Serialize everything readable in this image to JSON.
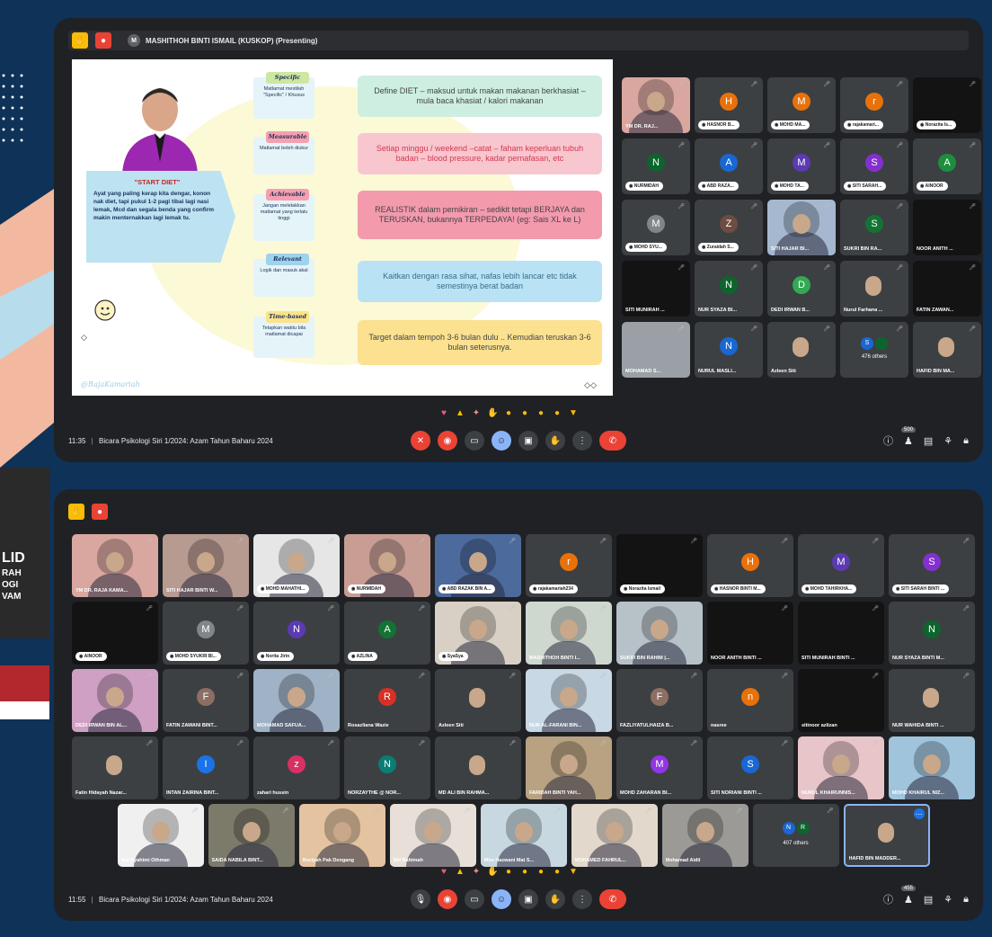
{
  "colors": {
    "bg": "#0e3258",
    "meet": "#202124",
    "tile": "#3c4043",
    "red": "#ea4335",
    "yellow": "#fbbc04",
    "blue": "#8ab4f8"
  },
  "left_poster": {
    "lines": [
      "LID",
      "RAH",
      "OGI",
      "VAM"
    ]
  },
  "window1": {
    "presenter": "MASHITHOH BINTI ISMAIL (KUSKOP) (Presenting)",
    "slide": {
      "start_title": "\"START DIET\"",
      "start_body": "Ayat yang paling kerap kita dengar, konon nak diet, tapi pukul 1-2 pagi tibai lagi nasi lemak, Mcd dan segala benda yang confirm makin menternakkan lagi lemak tu.",
      "steps": [
        {
          "tag": "Specific",
          "body": "Matlamat mestilah \"Specific\" / Khusus"
        },
        {
          "tag": "Measurable",
          "body": "Matlamat boleh diukur"
        },
        {
          "tag": "Achievable",
          "body": "Jangan meletakkan matlamat yang terlalu tinggi"
        },
        {
          "tag": "Relevant",
          "body": "Logik dan masuk akal"
        },
        {
          "tag": "Time-based",
          "body": "Tetapkan waktu bila matlamat dicapai"
        }
      ],
      "boxes": [
        "Define DIET – maksud untuk makan makanan berkhasiat – mula baca khasiat / kalori makanan",
        "Setiap minggu / weekend –catat – faham keperluan tubuh badan – blood pressure, kadar pernafasan, etc",
        "REALISTIK dalam pemikiran – sedikit tetapi BERJAYA dan TERUSKAN, bukannya TERPEDAYA! (eg: Sais XL ke L)",
        "Kaitkan dengan rasa sihat, nafas lebih lancar etc tidak semestinya berat badan",
        "Target dalam tempoh 3-6 bulan dulu .. Kemudian teruskan 3-6 bulan seterusnya."
      ],
      "watermark": "@RajaKamariah"
    },
    "time": "11:35",
    "meeting": "Bicara Psikologi Siri 1/2024: Azam Tahun Baharu 2024",
    "participants_count": "500",
    "tiles": [
      {
        "name": "YM DR. RAJ...",
        "type": "video",
        "tone": "#d9a7a0"
      },
      {
        "name": "HASNOR B...",
        "letter": "H",
        "color": "#e8710a",
        "pill": true
      },
      {
        "name": "MOHD MA...",
        "letter": "M",
        "color": "#e8710a",
        "pill": true
      },
      {
        "name": "rajakamari...",
        "letter": "r",
        "color": "#e8710a",
        "pill": true
      },
      {
        "name": "Norazita Is...",
        "type": "dark",
        "pill": true
      },
      {
        "name": "NURMIDAH",
        "letter": "N",
        "color": "#0d652d",
        "pill": true
      },
      {
        "name": "ABD RAZA...",
        "letter": "A",
        "color": "#1967d2",
        "pill": true
      },
      {
        "name": "MOHD TA...",
        "letter": "M",
        "color": "#5b3ab3",
        "pill": true
      },
      {
        "name": "SITI SARAH...",
        "letter": "S",
        "color": "#8430ce",
        "pill": true
      },
      {
        "name": "AINOOR",
        "letter": "A",
        "color": "#1e8e3e",
        "pill": true
      },
      {
        "name": "MOHD SYU...",
        "letter": "M",
        "color": "#80868b",
        "pill": true
      },
      {
        "name": "Zuraidah S...",
        "letter": "Z",
        "color": "#6d4c41",
        "pill": true
      },
      {
        "name": "SITI HAJAR BI...",
        "type": "video",
        "tone": "#a5b8cf"
      },
      {
        "name": "SUKRI BIN RA...",
        "letter": "S",
        "color": "#137333"
      },
      {
        "name": "NOOR ANITH ...",
        "type": "dark"
      },
      {
        "name": "SITI MUNIRAH ...",
        "type": "dark"
      },
      {
        "name": "NUR SYAZA BI...",
        "letter": "N",
        "color": "#0d652d"
      },
      {
        "name": "DEDI IRWAN B...",
        "letter": "D",
        "color": "#34a853"
      },
      {
        "name": "Nurul Farhana ...",
        "type": "person"
      },
      {
        "name": "FATIN ZAWAN...",
        "type": "dark"
      },
      {
        "name": "MOHAMAD S...",
        "type": "light"
      },
      {
        "name": "NURUL MASLI...",
        "letter": "N",
        "color": "#1967d2"
      },
      {
        "name": "Azleen Siti",
        "type": "person"
      },
      {
        "name": "476 others",
        "type": "others",
        "letters": [
          "S",
          ""
        ]
      },
      {
        "name": "HAFID BIN MA...",
        "type": "person"
      }
    ]
  },
  "window2": {
    "time": "11:55",
    "meeting": "Bicara Psikologi Siri 1/2024: Azam Tahun Baharu 2024",
    "participants_count": "455",
    "tiles": [
      {
        "name": "YM DR. RAJA KAMA...",
        "type": "video",
        "tone": "#d9a7a0"
      },
      {
        "name": "SITI HAJAR BINTI W...",
        "type": "video",
        "tone": "#b79a90"
      },
      {
        "name": "MOHD MAHATHI...",
        "type": "video",
        "tone": "#e6e6e6",
        "pill": true
      },
      {
        "name": "NURMIDAH",
        "type": "video",
        "tone": "#c79d94",
        "pill": true
      },
      {
        "name": "ABD RAZAK BIN A...",
        "type": "video",
        "tone": "#4c6a9c",
        "pill": true
      },
      {
        "name": "rajakamariah234",
        "letter": "r",
        "color": "#e8710a",
        "pill": true
      },
      {
        "name": "Norazita Ismail",
        "type": "dark",
        "pill": true
      },
      {
        "name": "HASNOR BINTI M...",
        "letter": "H",
        "color": "#e8710a",
        "pill": true
      },
      {
        "name": "MOHD TAHIRKHA...",
        "letter": "M",
        "color": "#5b3ab3",
        "pill": true
      },
      {
        "name": "SITI SARAH BINTI ...",
        "letter": "S",
        "color": "#8430ce",
        "pill": true
      },
      {
        "name": "AINOOR",
        "type": "dark",
        "pill": true
      },
      {
        "name": "MOHD SYUKRI BI...",
        "letter": "M",
        "color": "#80868b",
        "pill": true
      },
      {
        "name": "Norita Jirin",
        "letter": "N",
        "color": "#5b3ab3",
        "pill": true
      },
      {
        "name": "AZLINA",
        "letter": "A",
        "color": "#137333",
        "pill": true
      },
      {
        "name": "SyaSya",
        "type": "video",
        "tone": "#d8d0c4",
        "pill": true
      },
      {
        "name": "MASHITHOH BINTI I...",
        "type": "video",
        "tone": "#cfd8cf"
      },
      {
        "name": "SUKRI BIN RAHIM (...",
        "type": "video",
        "tone": "#b7c2c8"
      },
      {
        "name": "NOOR ANITH BINTI ...",
        "type": "dark"
      },
      {
        "name": "SITI MUNIRAH BINTI ...",
        "type": "dark"
      },
      {
        "name": "NUR SYAZA BINTI M...",
        "letter": "N",
        "color": "#0d652d"
      },
      {
        "name": "DEDI IRWAN BIN AL...",
        "type": "video",
        "tone": "#cfa0c4"
      },
      {
        "name": "FATIN ZAWANI BINT...",
        "letter": "F",
        "color": "#8d6e63"
      },
      {
        "name": "MOHAMAD SAFUA...",
        "type": "video",
        "tone": "#9fb2c6"
      },
      {
        "name": "Rosazliana Wazie",
        "letter": "R",
        "color": "#d93025"
      },
      {
        "name": "Azleen Siti",
        "type": "person"
      },
      {
        "name": "NUR AL-FARANI BIN...",
        "type": "video",
        "tone": "#c8d8e4"
      },
      {
        "name": "FAZLIYATULHAIZA B...",
        "letter": "F",
        "color": "#8d6e63"
      },
      {
        "name": "nasree",
        "letter": "n",
        "color": "#e8710a"
      },
      {
        "name": "sitinoor azlizan",
        "type": "dark"
      },
      {
        "name": "NUR WAHIDA BINTI ...",
        "type": "person"
      },
      {
        "name": "Fatin Hidayah Nazar...",
        "type": "person"
      },
      {
        "name": "INTAN ZAIRINA BINT...",
        "letter": "I",
        "color": "#1a73e8"
      },
      {
        "name": "zahari hussin",
        "letter": "z",
        "color": "#d93063"
      },
      {
        "name": "NORZAYTHE @ NOR...",
        "letter": "N",
        "color": "#0b7d75"
      },
      {
        "name": "MD ALI BIN RAHMA...",
        "type": "person"
      },
      {
        "name": "FARIDAH BINTI YAH...",
        "type": "video",
        "tone": "#b8a282"
      },
      {
        "name": "MOHD ZAHARAN BI...",
        "letter": "M",
        "color": "#9334e6"
      },
      {
        "name": "SITI NORIANI BINTI ...",
        "letter": "S",
        "color": "#1967d2"
      },
      {
        "name": "NURUL KHAIRUNNIS...",
        "type": "video",
        "tone": "#e7c5c8"
      },
      {
        "name": "MOHD KHAIRUL NIZ...",
        "type": "video",
        "tone": "#9fc4dc"
      },
      {
        "name": "Nur Syahimi Othman",
        "type": "video",
        "tone": "#f0f0f0"
      },
      {
        "name": "SAIDA NABILA BINT...",
        "type": "video",
        "tone": "#7c7a6a"
      },
      {
        "name": "Roziyah Pak Dengang",
        "type": "video",
        "tone": "#e3c3a0"
      },
      {
        "name": "Siti Rahimah",
        "type": "video",
        "tone": "#e8e0d8"
      },
      {
        "name": "Mira Hazwani Mat S...",
        "type": "video",
        "tone": "#c7d8e0"
      },
      {
        "name": "MOHAMED FAHRUL...",
        "type": "video",
        "tone": "#e2d8cc"
      },
      {
        "name": "Mohamad Aidil",
        "type": "video",
        "tone": "#9c9a96"
      },
      {
        "name": "407 others",
        "type": "others",
        "letters": [
          "N",
          "R"
        ]
      },
      {
        "name": "HAFID BIN MADDER...",
        "type": "person",
        "active": true
      }
    ]
  }
}
